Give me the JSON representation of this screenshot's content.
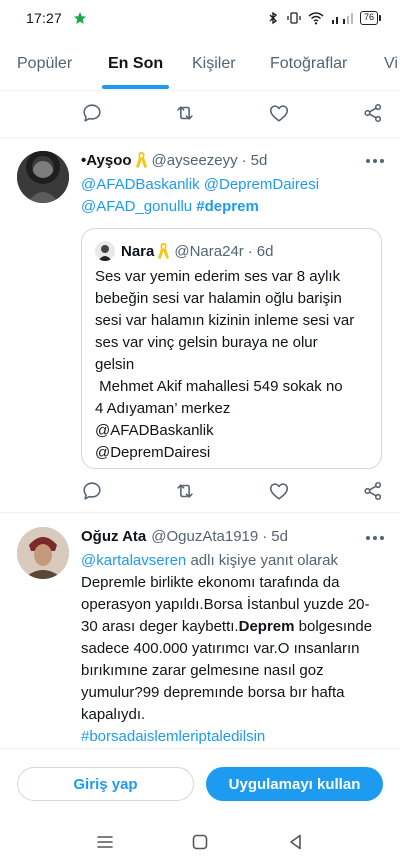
{
  "status_bar": {
    "time": "17:27",
    "battery": "76"
  },
  "tabs": [
    {
      "label": "Popüler",
      "active": false
    },
    {
      "label": "En Son",
      "active": true
    },
    {
      "label": "Kişiler",
      "active": false
    },
    {
      "label": "Fotoğraflar",
      "active": false
    },
    {
      "label": "Vi",
      "active": false
    }
  ],
  "tweets": [
    {
      "name": "•Ayşoo",
      "handle": "@ayseezeyy",
      "time": "5d",
      "mentions": [
        "@AFADBaskanlik",
        "@DepremDairesi",
        "@AFAD_gonullu"
      ],
      "hashtag": "#deprem",
      "quote": {
        "name": "Nara",
        "handle": "@Nara24r",
        "time": "6d",
        "text_lines": [
          "Ses var yemin ederim ses var 8 aylık",
          "bebeğin sesi var halamin oğlu barişin",
          "sesi var halamın kizinin inleme sesi var",
          "ses var vinç gelsin buraya ne olur",
          "gelsin",
          " Mehmet Akif mahallesi 549 sokak no",
          "4 Adıyaman’ merkez",
          "@AFADBaskanlik",
          "@DepremDairesi"
        ]
      }
    },
    {
      "name": "Oğuz Ata",
      "handle": "@OguzAta1919",
      "time": "5d",
      "reply_to": "@kartalavseren",
      "reply_suffix": "adlı kişiye yanıt olarak",
      "text": {
        "p1": "Depremle birlikte ekonomı tarafında da operasyon yapıldı.Borsa İstanbul yuzde 20-30 arası deger kaybettı.",
        "bold": "Deprem",
        "p2": " bolgesınde sadece 400.000 yatırımcı var.O ınsanların bırıkımıne zarar gelmesıne nasıl goz yumulur?99 depremınde borsa bır hafta kapalıydı."
      },
      "hashtag": "#borsadaislemleriptaledilsin"
    }
  ],
  "cta": {
    "login": "Giriş yap",
    "app": "Uygulamayı kullan"
  },
  "colors": {
    "accent": "#1d9bf0",
    "secondary_text": "#536471",
    "border": "#cfd9de"
  },
  "icons": [
    "reply-icon",
    "retweet-icon",
    "like-icon",
    "share-icon",
    "more-icon",
    "ribbon-icon"
  ]
}
